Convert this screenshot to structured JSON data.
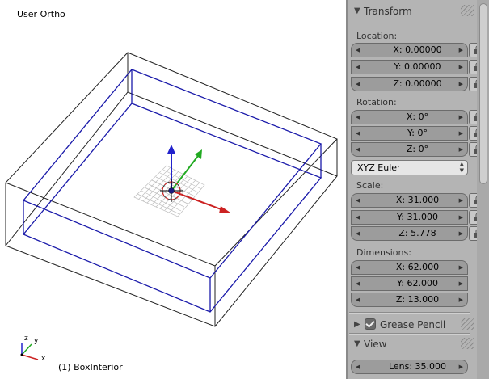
{
  "viewport": {
    "view_label": "User Ortho",
    "object_label": "(1) BoxInterior",
    "axis_x": "x",
    "axis_y": "y",
    "axis_z": "z"
  },
  "panel": {
    "transform": {
      "title": "Transform",
      "location_label": "Location:",
      "location": [
        "X: 0.00000",
        "Y: 0.00000",
        "Z: 0.00000"
      ],
      "rotation_label": "Rotation:",
      "rotation": [
        "X: 0°",
        "Y: 0°",
        "Z: 0°"
      ],
      "rotation_mode": "XYZ Euler",
      "scale_label": "Scale:",
      "scale": [
        "X: 31.000",
        "Y: 31.000",
        "Z: 5.778"
      ],
      "dimensions_label": "Dimensions:",
      "dimensions": [
        "X: 62.000",
        "Y: 62.000",
        "Z: 13.000"
      ]
    },
    "grease_pencil": {
      "title": "Grease Pencil",
      "enabled": true
    },
    "view": {
      "title": "View",
      "lens": "Lens: 35.000"
    }
  },
  "colors": {
    "viewport_bg": "#ffffff",
    "panel_bg": "#b4b4b4",
    "selected_edges": "#0000aa",
    "axis_x": "#cc2222",
    "axis_y": "#22aa22",
    "axis_z": "#2222cc"
  },
  "icons": [
    "lock-icon",
    "collapse-triangle-icon",
    "expand-triangle-icon",
    "checkbox-icon",
    "dropdown-arrows-icon"
  ]
}
